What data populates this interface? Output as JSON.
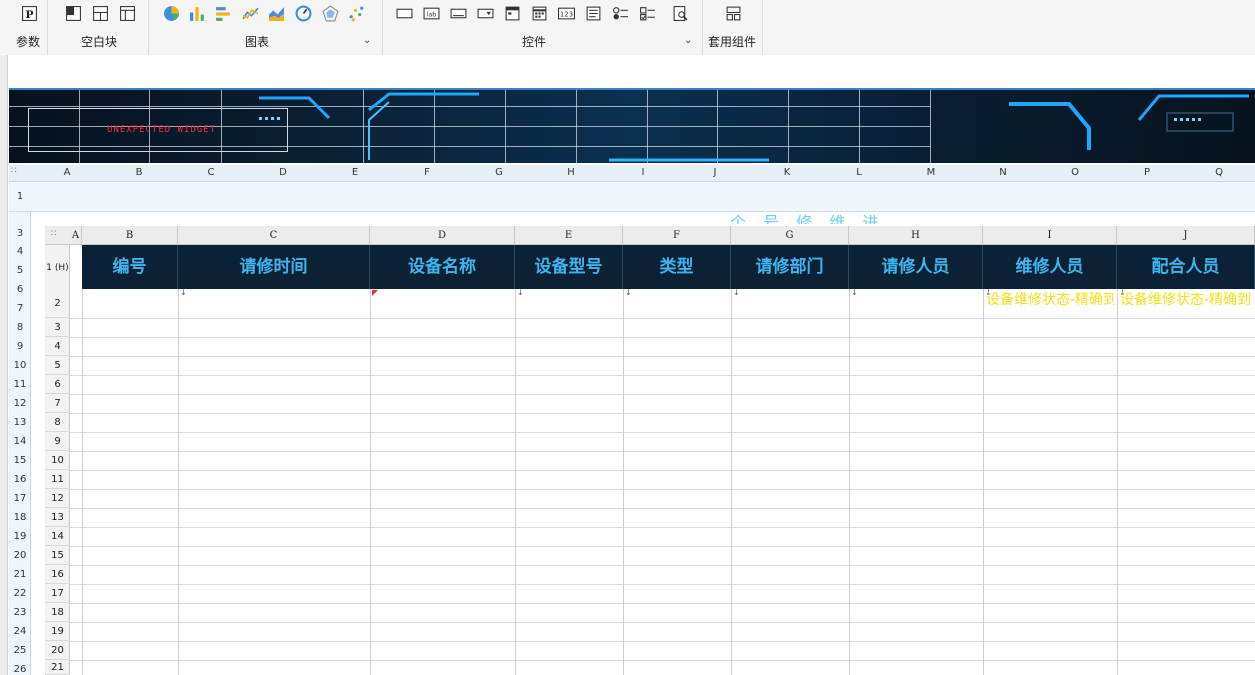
{
  "toolbar": {
    "groups": [
      {
        "label": "参数"
      },
      {
        "label": "空白块"
      },
      {
        "label": "图表"
      },
      {
        "label": "控件"
      },
      {
        "label": "套用组件"
      }
    ],
    "param_icon_letter": "P",
    "text_widget_label": "lab",
    "number_widget_label": "123"
  },
  "banner": {
    "widget_text": "UNEXPECTED WIDGET"
  },
  "outer_sheet": {
    "columns": [
      "A",
      "B",
      "C",
      "D",
      "E",
      "F",
      "G",
      "H",
      "I",
      "J",
      "K",
      "L",
      "M",
      "N",
      "O",
      "P",
      "Q"
    ],
    "rows": [
      "1",
      "3",
      "4",
      "5",
      "6",
      "7",
      "8",
      "9",
      "10",
      "11",
      "12",
      "13",
      "14",
      "15",
      "16",
      "17",
      "18",
      "19",
      "20",
      "21",
      "22",
      "23",
      "24",
      "25",
      "26"
    ],
    "title_partial": "个 号 修 维 进 度"
  },
  "inner_sheet": {
    "columns": [
      "A",
      "B",
      "C",
      "D",
      "E",
      "F",
      "G",
      "H",
      "I",
      "J"
    ],
    "row_header_label": "1 (H)",
    "rows": [
      "2",
      "3",
      "4",
      "5",
      "6",
      "7",
      "8",
      "9",
      "10",
      "11",
      "12",
      "13",
      "14",
      "15",
      "16",
      "17",
      "18",
      "19",
      "20",
      "21"
    ],
    "headers": [
      "编号",
      "请修时间",
      "设备名称",
      "设备型号",
      "类型",
      "请修部门",
      "请修人员",
      "维修人员",
      "配合人员"
    ],
    "status_text": "设备维修状态-精确到时分"
  }
}
